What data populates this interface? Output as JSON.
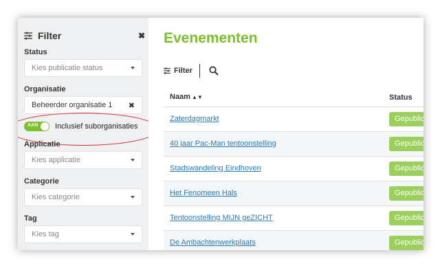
{
  "sidebar": {
    "title": "Filter",
    "close_label": "✖",
    "status": {
      "label": "Status",
      "placeholder": "Kies publicatie status"
    },
    "organisatie": {
      "label": "Organisatie",
      "value": "Beheerder organisatie 1",
      "clear": "✖"
    },
    "toggle": {
      "state": "AAN",
      "label": "Inclusief suborganisaties"
    },
    "applicatie": {
      "label": "Applicatie",
      "placeholder": "Kies applicatie"
    },
    "categorie": {
      "label": "Categorie",
      "placeholder": "Kies categorie"
    },
    "tag": {
      "label": "Tag",
      "placeholder": "Kies tag"
    }
  },
  "main": {
    "title": "Evenementen",
    "filter_button": "Filter",
    "columns": {
      "name": "Naam",
      "sort": "▲▼",
      "status": "Status"
    },
    "rows": [
      {
        "name": "Zaterdagmarkt",
        "status": "Gepubliceerd"
      },
      {
        "name": "40 jaar Pac-Man tentoonstelling",
        "status": "Gepubliceerd"
      },
      {
        "name": "Stadswandeling Eindhoven",
        "status": "Gepubliceerd"
      },
      {
        "name": "Het Fenomeen Hals",
        "status": "Gepubliceerd"
      },
      {
        "name": "Tentoonstelling MIJN geZICHT",
        "status": "Gepubliceerd"
      },
      {
        "name": "De Ambachtenwerkplaats",
        "status": "Gepubliceerd"
      }
    ]
  },
  "colors": {
    "accent": "#7bbf2a",
    "badge": "#9bcf5e",
    "link": "#2a7ab5",
    "highlight": "#d8262d"
  }
}
